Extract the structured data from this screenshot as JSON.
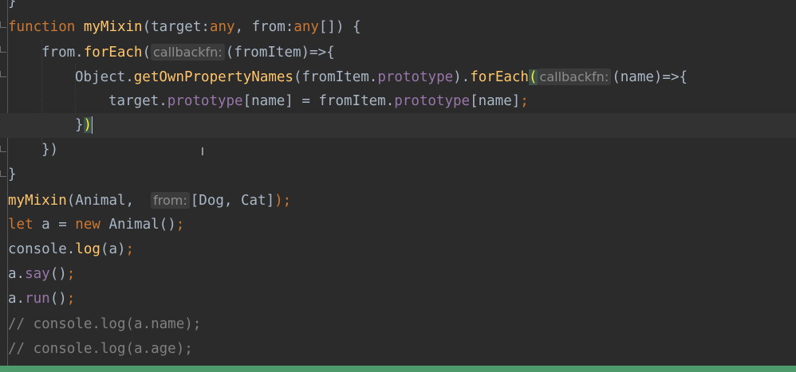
{
  "editor": {
    "lines": [
      {
        "text": "}"
      },
      {
        "kw1": "function",
        "fname": "myMixin",
        "p1": "(target:",
        "t1": "any",
        "p2": ", from:",
        "t2": "any",
        "p3": "[]) {"
      },
      {
        "obj": "from.",
        "fn": "forEach",
        "open": "(",
        "hint": "callbackfn:",
        "rest": "(fromItem)=>{"
      },
      {
        "obj": "Object.",
        "fn": "getOwnPropertyNames",
        "a": "(fromItem.",
        "prop": "prototype",
        "b": ").",
        "fn2": "forEach",
        "open": "(",
        "hint": "callbackfn:",
        "rest": "(name)=>{"
      },
      {
        "a": "target.",
        "prop1": "prototype",
        "b": "[name] = fromItem.",
        "prop2": "prototype",
        "c": "[name]",
        "semi": ";"
      },
      {
        "a": "})"
      },
      {
        "a": "})"
      },
      {
        "a": "}"
      },
      {
        "fname": "myMixin",
        "a": "(Animal,",
        "hint": "from:",
        "b": "[Dog, Cat]",
        "semi": ");"
      },
      {
        "kw1": "let",
        "a": " a = ",
        "kw2": "new",
        "b": " Animal()",
        "semi": ";"
      },
      {
        "a": "console.",
        "fn": "log",
        "b": "(a)",
        "semi": ";"
      },
      {
        "a": "a.",
        "fn": "say",
        "b": "()",
        "semi": ";"
      },
      {
        "a": "a.",
        "fn": "run",
        "b": "()",
        "semi": ";"
      },
      {
        "comment": "// console.log(a.name);"
      },
      {
        "comment": "// console.log(a.age);"
      }
    ]
  },
  "colors": {
    "background": "#2b2b2b",
    "keyword": "#cc7832",
    "function": "#ffc66d",
    "property": "#9876aa",
    "comment": "#808080",
    "text": "#a9b7c6",
    "statusbar": "#4e9a6a"
  }
}
